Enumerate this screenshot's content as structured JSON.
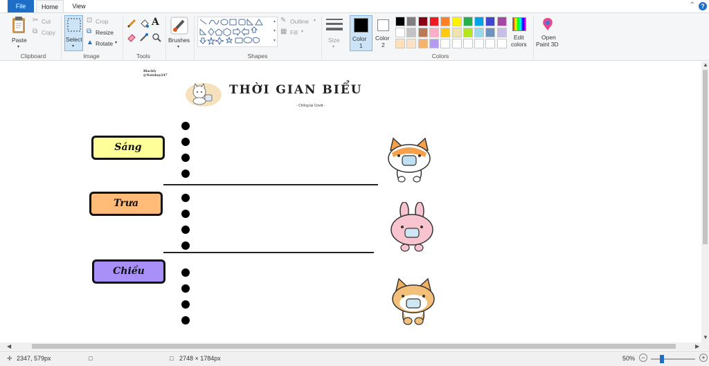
{
  "tabs": {
    "file": "File",
    "home": "Home",
    "view": "View"
  },
  "ribbon": {
    "clipboard": {
      "paste": "Paste",
      "cut": "Cut",
      "copy": "Copy",
      "group": "Clipboard"
    },
    "image": {
      "select": "Select",
      "crop": "Crop",
      "resize": "Resize",
      "rotate": "Rotate",
      "group": "Image"
    },
    "tools": {
      "group": "Tools"
    },
    "brushes": {
      "label": "Brushes"
    },
    "shapes": {
      "outline": "Outline",
      "fill": "Fill",
      "group": "Shapes"
    },
    "size": {
      "label": "Size"
    },
    "colors": {
      "color1": "Color",
      "color1_num": "1",
      "color2": "Color",
      "color2_num": "2",
      "edit": "Edit",
      "edit2": "colors",
      "open3d": "Open",
      "open3d2": "Paint 3D",
      "group": "Colors",
      "palette_row1": [
        "#000000",
        "#7f7f7f",
        "#880015",
        "#ed1c24",
        "#ff7f27",
        "#fff200",
        "#22b14c",
        "#00a2e8",
        "#3f48cc",
        "#a349a4"
      ],
      "palette_row2": [
        "#ffffff",
        "#c3c3c3",
        "#b97a57",
        "#ffaec9",
        "#ffc90e",
        "#efe4b0",
        "#b5e61d",
        "#99d9ea",
        "#7092be",
        "#c8bfe7"
      ],
      "palette_row3": [
        "#ffe0b8",
        "#fde3c5",
        "#f5b36c",
        "#b69cf0",
        "#ffffff",
        "#ffffff",
        "#ffffff",
        "#ffffff",
        "#ffffff",
        "#ffffff"
      ]
    }
  },
  "canvas": {
    "tiny_line1": "Blackly",
    "tiny_line2": "@Notebay247",
    "title": "THỜI GIAN BIỂU",
    "subtitle": "- Chống lại Covid -",
    "slots": [
      {
        "label": "Sáng",
        "color": "#ffff99"
      },
      {
        "label": "Trưa",
        "color": "#ffbb77"
      },
      {
        "label": "Chiều",
        "color": "#a890f8"
      }
    ]
  },
  "status": {
    "cursor": "2347, 579px",
    "canvas_size": "2748 × 1784px",
    "zoom": "50%"
  }
}
